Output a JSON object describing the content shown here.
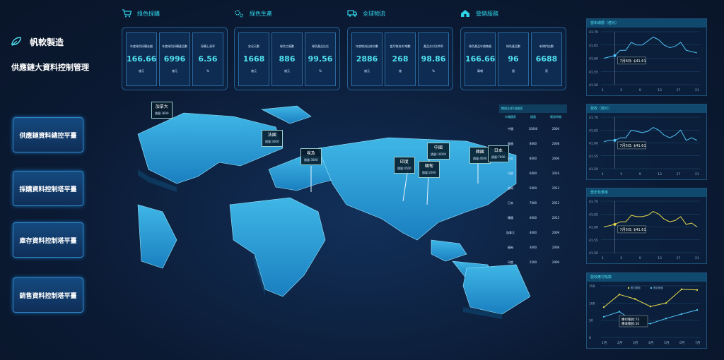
{
  "brand": {
    "name": "帆軟製造",
    "system_title": "供應鏈大資料控制管理"
  },
  "sidebar": {
    "items": [
      {
        "label": "供應鏈資料總控平臺"
      },
      {
        "label": "採購資料控制塔平臺"
      },
      {
        "label": "庫存資料控制塔平臺"
      },
      {
        "label": "銷售資料控制塔平臺"
      }
    ]
  },
  "kpi_groups": [
    {
      "title": "綠色採購",
      "icon": "cart-icon",
      "cells": [
        {
          "label": "年度綠色採購金額",
          "value": "166.66",
          "unit": "億元"
        },
        {
          "label": "年度綠色採購產品數",
          "value": "6996",
          "unit": "億元"
        },
        {
          "label": "採購上漲率",
          "value": "6.56",
          "unit": "%"
        }
      ]
    },
    {
      "title": "綠色生產",
      "icon": "gears-icon",
      "cells": [
        {
          "label": "安全天數",
          "value": "1668",
          "unit": "億元"
        },
        {
          "label": "綠色工廠數",
          "value": "886",
          "unit": "億元"
        },
        {
          "label": "綠色產品佔比",
          "value": "99.56",
          "unit": "%"
        }
      ]
    },
    {
      "title": "全球物流",
      "icon": "truck-icon",
      "cells": [
        {
          "label": "年度物流出貨次數",
          "value": "2886",
          "unit": "億元"
        },
        {
          "label": "當月物流次/噸數",
          "value": "268",
          "unit": "億"
        },
        {
          "label": "產品交付及時率",
          "value": "98.86",
          "unit": "%"
        }
      ]
    },
    {
      "title": "營銷服務",
      "icon": "house-icon",
      "cells": [
        {
          "label": "綠色產品年銷售額",
          "value": "166.66",
          "unit": "萬噸"
        },
        {
          "label": "綠色產品數",
          "value": "96",
          "unit": "個"
        },
        {
          "label": "新增門店數",
          "value": "6688",
          "unit": "家"
        }
      ]
    }
  ],
  "map": {
    "pins": [
      {
        "name": "加拿大",
        "sub": "銷量:3600"
      },
      {
        "name": "法國",
        "sub": "銷量:3000"
      },
      {
        "name": "埃及",
        "sub": "銷量:3000"
      },
      {
        "name": "印度",
        "sub": "銷量:4500"
      },
      {
        "name": "中國",
        "sub": "銷量:10000"
      },
      {
        "name": "緬甸",
        "sub": "銷量:2000"
      },
      {
        "name": "韓國",
        "sub": "銷量:4000"
      },
      {
        "name": "日本",
        "sub": "銷量:7000"
      }
    ]
  },
  "sales_table": {
    "title": "暢銷全球5個國家",
    "headers": [
      "市場國家",
      "銷量",
      "貿易時間"
    ],
    "rows": [
      [
        "中國",
        "10000",
        "2000"
      ],
      [
        "美國",
        "8000",
        "2008"
      ],
      [
        "日本",
        "8000",
        "2006"
      ],
      [
        "印度",
        "6000",
        "2016"
      ],
      [
        "緬甸",
        "5000",
        "2012"
      ],
      [
        "日本",
        "7000",
        "2012"
      ],
      [
        "韓國",
        "4000",
        "2015"
      ],
      [
        "加拿大",
        "4000",
        "2009"
      ],
      [
        "緬甸",
        "3000",
        "2008"
      ],
      [
        "印度",
        "2500",
        "2009"
      ]
    ]
  },
  "charts": [
    {
      "title": "當年總額（億元）",
      "color": "#4fc3f7",
      "type": "line",
      "y_ticks": [
        "41.70",
        "41.65",
        "41.60",
        "41.55",
        "41.50"
      ],
      "x_ticks": [
        "1",
        "5",
        "9",
        "13",
        "17",
        "21"
      ],
      "tooltip": "7月6日: $41.61",
      "values": [
        41.6,
        41.605,
        41.61,
        41.63,
        41.63,
        41.66,
        41.65,
        41.65,
        41.665,
        41.68,
        41.67,
        41.65,
        41.64,
        41.645,
        41.66,
        41.63,
        41.625,
        41.62
      ],
      "ylim": [
        41.5,
        41.7
      ]
    },
    {
      "title": "營收（億元）",
      "color": "#4fc3f7",
      "type": "line",
      "y_ticks": [
        "41.70",
        "41.65",
        "41.60",
        "41.55",
        "41.50"
      ],
      "x_ticks": [
        "1",
        "5",
        "9",
        "13",
        "17",
        "21"
      ],
      "tooltip": "7月5日: $41.61",
      "values": [
        41.605,
        41.61,
        41.61,
        41.62,
        41.62,
        41.65,
        41.645,
        41.64,
        41.645,
        41.66,
        41.65,
        41.63,
        41.62,
        41.63,
        41.65,
        41.61,
        41.62,
        41.61
      ],
      "ylim": [
        41.5,
        41.7
      ]
    },
    {
      "title": "當年負債率",
      "color": "#e6d84a",
      "type": "line",
      "y_ticks": [
        "41.70",
        "41.65",
        "41.60",
        "41.55",
        "41.50"
      ],
      "x_ticks": [
        "1",
        "5",
        "9",
        "13",
        "17",
        "21"
      ],
      "tooltip": "7月5日: $41.61",
      "values": [
        41.6,
        41.605,
        41.61,
        41.62,
        41.62,
        41.645,
        41.64,
        41.64,
        41.645,
        41.66,
        41.65,
        41.63,
        41.62,
        41.625,
        41.64,
        41.61,
        41.615,
        41.6
      ],
      "ylim": [
        41.5,
        41.7
      ]
    },
    {
      "title": "營收應付賬款",
      "type": "dual",
      "y_ticks": [
        "150",
        "100",
        "50",
        "0"
      ],
      "x_ticks": [
        "1月",
        "2月",
        "3月",
        "4月",
        "5月",
        "6月",
        "7月"
      ],
      "tooltip_lines": [
        "應付賬款:73",
        "應收帳款:50"
      ],
      "series": [
        {
          "name": "應付賬款",
          "color": "#e6d84a",
          "values": [
            88,
            125,
            112,
            90,
            100,
            140,
            138
          ]
        },
        {
          "name": "應收帳款",
          "color": "#4fc3f7",
          "values": [
            60,
            75,
            45,
            40,
            55,
            68,
            80
          ]
        }
      ],
      "ylim": [
        0,
        150
      ]
    }
  ],
  "colors": {
    "accent": "#2fd3e8",
    "bg": "#0b1a33",
    "panel": "#0f4a6e"
  }
}
